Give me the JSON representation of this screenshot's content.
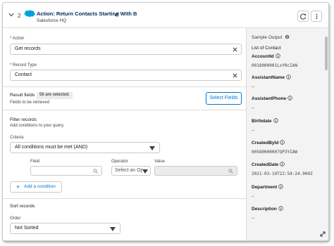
{
  "header": {
    "step_number": "2",
    "title": "Action: Return Contacts Starting With B",
    "subtitle": "Salesforce HQ"
  },
  "action": {
    "label": "Action",
    "required": "*",
    "value": "Get records"
  },
  "record_type": {
    "label": "Record Type",
    "required": "*",
    "value": "Contact"
  },
  "result_fields": {
    "title": "Result fields",
    "badge": "56 are selected.",
    "subtitle": "Fields to be retrieved",
    "button": "Select Fields"
  },
  "filter": {
    "title": "Filter records",
    "subtitle": "Add conditions to your query.",
    "criteria_label": "Criteria",
    "criteria_value": "All conditions must be met (AND)",
    "field_label": "Field",
    "operator_label": "Operator",
    "operator_value": "Select an Op",
    "value_label": "Value",
    "add_condition": "Add a condition"
  },
  "sort": {
    "title": "Sort records",
    "order_label": "Order",
    "order_value": "Not Sorted"
  },
  "sample_output": {
    "title": "Sample Output",
    "list_title": "List of Contact",
    "rows": [
      {
        "key": "AccountId",
        "value": "0018000001LxYRcIAN"
      },
      {
        "key": "AssistantName",
        "value": "–"
      },
      {
        "key": "AssistantPhone",
        "value": "–"
      },
      {
        "key": "Birthdate",
        "value": "–"
      },
      {
        "key": "CreatedById",
        "value": "00580000007QP3YIAW"
      },
      {
        "key": "CreatedDate",
        "value": "2021-03-10T22:54:24.000Z"
      },
      {
        "key": "Department",
        "value": "–"
      },
      {
        "key": "Description",
        "value": "–"
      }
    ]
  },
  "colors": {
    "brand_blue": "#0176d3",
    "title_navy": "#032d60",
    "salesforce_cloud": "#00a1e0"
  }
}
